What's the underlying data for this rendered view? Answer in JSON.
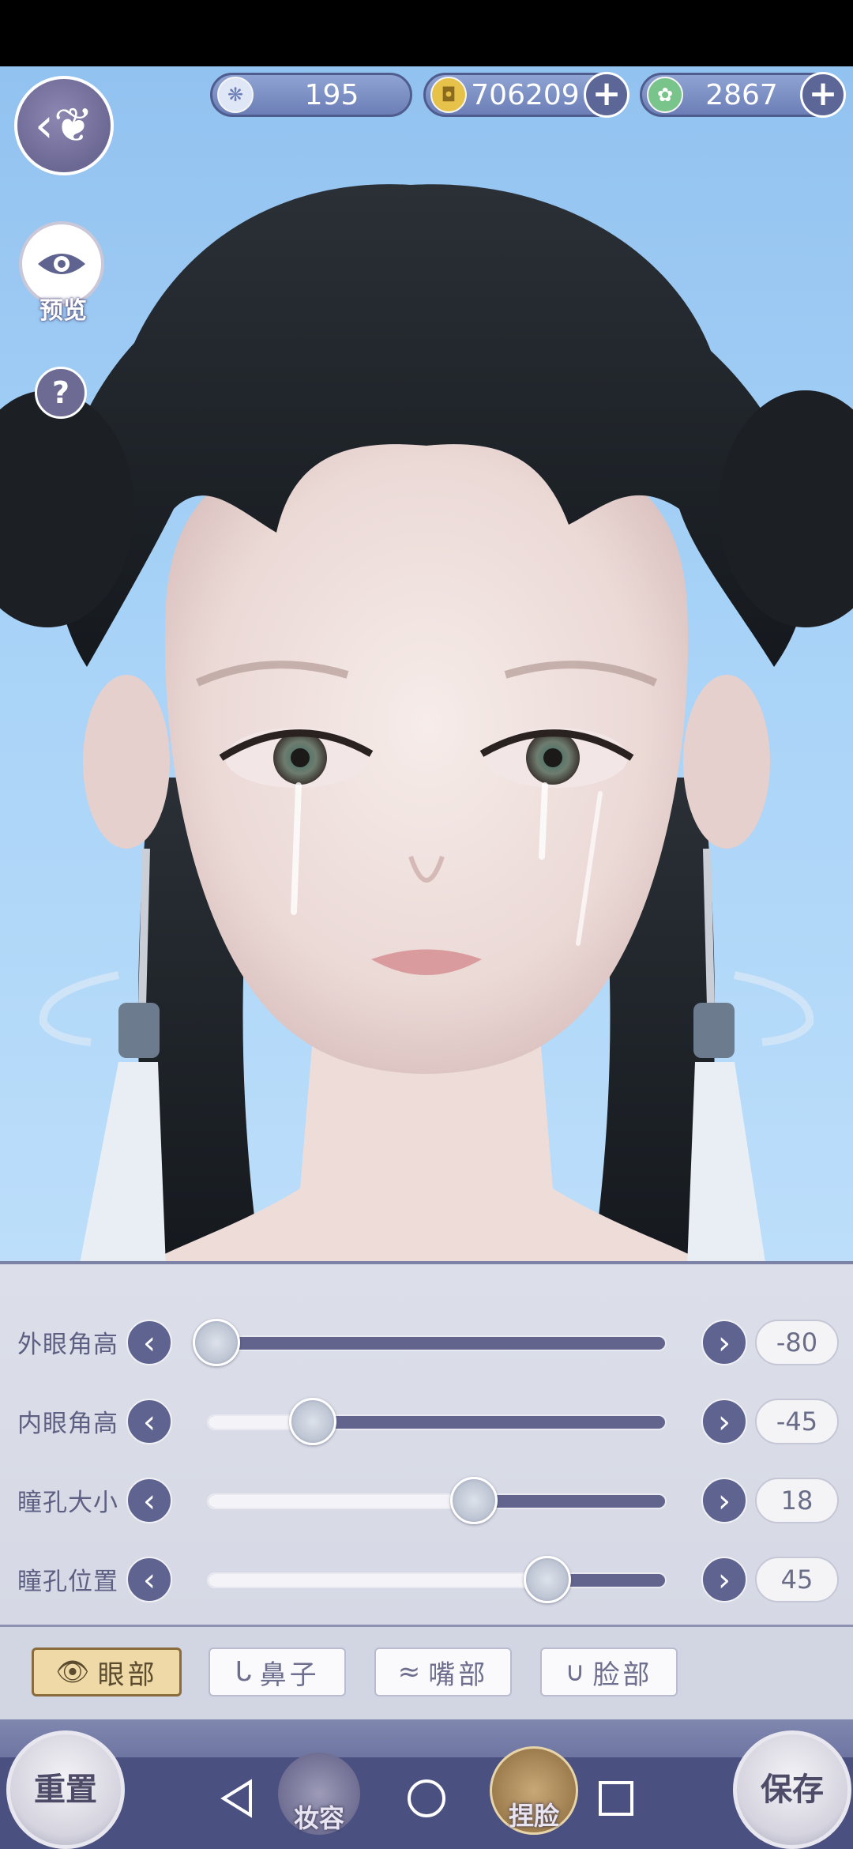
{
  "currency": {
    "feather": {
      "value": "195",
      "icon": "feather-coin-icon",
      "color": "#dfe7f6"
    },
    "copper": {
      "value": "706209",
      "icon": "copper-coin-icon",
      "color": "#e7c24a"
    },
    "jade": {
      "value": "2867",
      "icon": "jade-token-icon",
      "color": "#79c48b"
    }
  },
  "left_controls": {
    "preview_label": "预览",
    "help_label": "?"
  },
  "sliders": [
    {
      "label": "外眼角高",
      "value": "-80",
      "level": 0.02
    },
    {
      "label": "内眼角高",
      "value": "-45",
      "level": 0.23
    },
    {
      "label": "瞳孔大小",
      "value": "18",
      "level": 0.58
    },
    {
      "label": "瞳孔位置",
      "value": "45",
      "level": 0.74
    }
  ],
  "tabs": [
    {
      "label": "眼部",
      "icon": "eye-icon",
      "active": true
    },
    {
      "label": "鼻子",
      "icon": "nose-icon",
      "active": false
    },
    {
      "label": "嘴部",
      "icon": "lips-icon",
      "active": false
    },
    {
      "label": "脸部",
      "icon": "face-icon",
      "active": false
    }
  ],
  "bottom": {
    "reset_label": "重置",
    "makeup_label": "妆容",
    "face_label": "捏脸",
    "save_label": "保存"
  },
  "colors": {
    "accent": "#5e6390",
    "panel": "#d8dbe6",
    "active_tab": "#efd9a7"
  }
}
